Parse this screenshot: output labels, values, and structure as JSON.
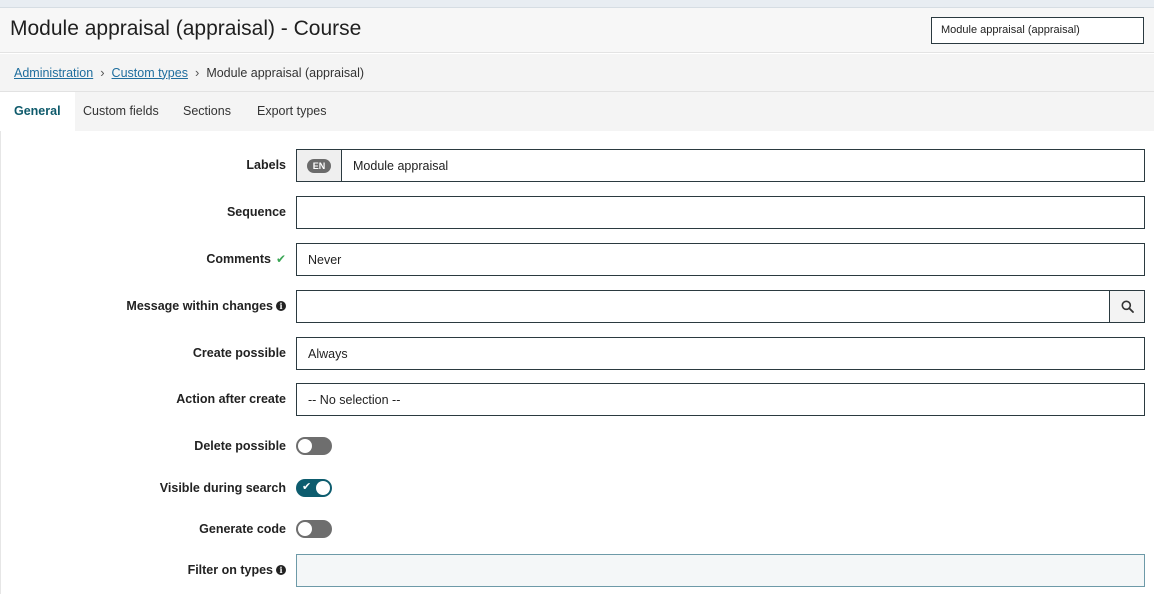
{
  "header": {
    "title": "Module appraisal (appraisal) - Course",
    "field_value": "Module appraisal (appraisal)"
  },
  "breadcrumb": {
    "items": [
      "Administration",
      "Custom types"
    ],
    "current": "Module appraisal (appraisal)"
  },
  "tabs": [
    {
      "label": "General",
      "active": true
    },
    {
      "label": "Custom fields",
      "active": false
    },
    {
      "label": "Sections",
      "active": false
    },
    {
      "label": "Export types",
      "active": false
    }
  ],
  "form": {
    "labels": {
      "label": "Labels",
      "lang": "EN",
      "value": "Module appraisal"
    },
    "sequence": {
      "label": "Sequence",
      "value": ""
    },
    "comments": {
      "label": "Comments",
      "value": "Never"
    },
    "message_within_changes": {
      "label": "Message within changes",
      "value": ""
    },
    "create_possible": {
      "label": "Create possible",
      "value": "Always"
    },
    "action_after_create": {
      "label": "Action after create",
      "value": "-- No selection --"
    },
    "delete_possible": {
      "label": "Delete possible",
      "enabled": false
    },
    "visible_during_search": {
      "label": "Visible during search",
      "enabled": true
    },
    "generate_code": {
      "label": "Generate code",
      "enabled": false
    },
    "filter_on_types": {
      "label": "Filter on types",
      "value": ""
    }
  },
  "icons": {
    "breadcrumb_separator": "chevron-right-icon",
    "comments_status": "check-icon",
    "info": "info-circle-icon",
    "search": "search-icon"
  },
  "colors": {
    "accent": "#0d5c6e",
    "link": "#1f6e9e",
    "success": "#3aa655"
  }
}
